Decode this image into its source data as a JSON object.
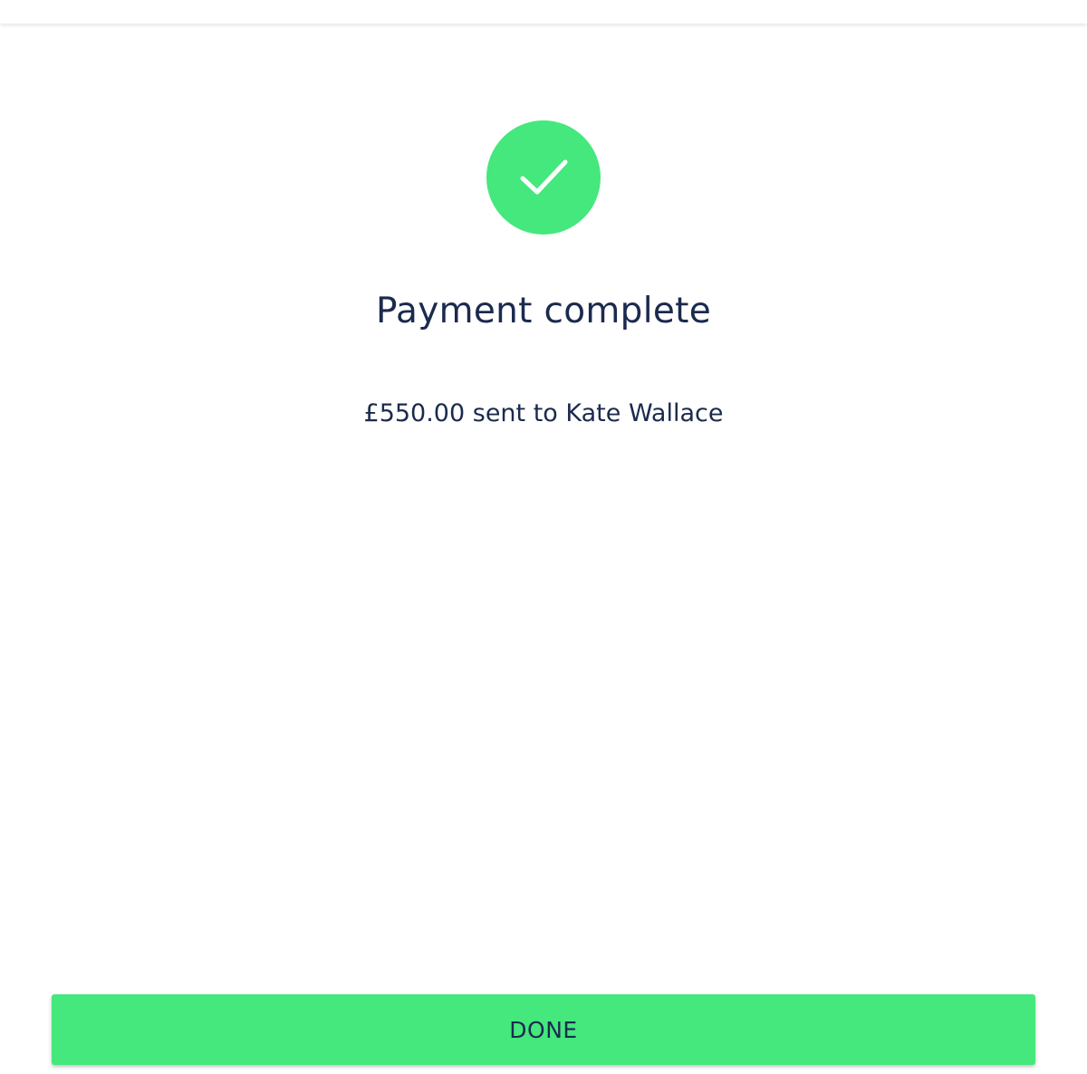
{
  "header": {},
  "status": {
    "icon": "check-circle-icon",
    "icon_color": "#44e87c"
  },
  "title": "Payment complete",
  "message": "£550.00 sent to Kate Wallace",
  "actions": {
    "done_label": "DONE",
    "done_color": "#44e87c"
  },
  "colors": {
    "text": "#1b2a4e",
    "background": "#ffffff"
  }
}
